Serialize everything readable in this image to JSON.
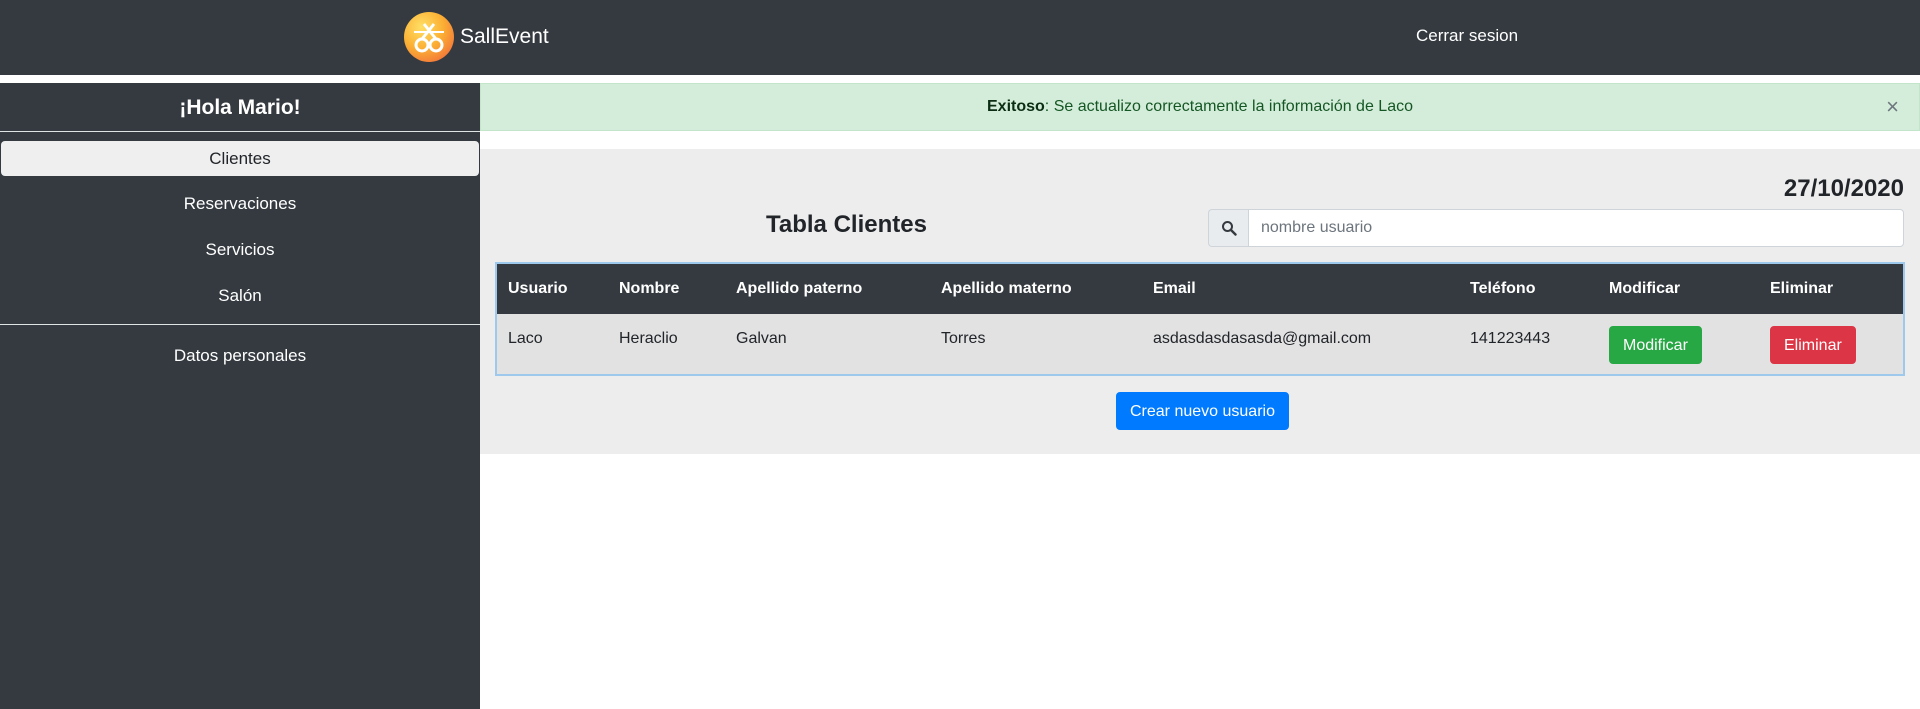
{
  "header": {
    "brand": "SallEvent",
    "logout_label": "Cerrar sesion"
  },
  "sidebar": {
    "greeting": "¡Hola Mario!",
    "items": [
      {
        "label": "Clientes",
        "active": true
      },
      {
        "label": "Reservaciones",
        "active": false
      },
      {
        "label": "Servicios",
        "active": false
      },
      {
        "label": "Salón",
        "active": false
      }
    ],
    "personal_label": "Datos personales"
  },
  "alert": {
    "strong": "Exitoso",
    "message": ": Se actualizo correctamente la información de Laco",
    "close": "×"
  },
  "main": {
    "date": "27/10/2020",
    "title": "Tabla Clientes",
    "search_placeholder": "nombre usuario",
    "search_value": "",
    "columns": [
      "Usuario",
      "Nombre",
      "Apellido paterno",
      "Apellido materno",
      "Email",
      "Teléfono",
      "Modificar",
      "Eliminar"
    ],
    "rows": [
      {
        "usuario": "Laco",
        "nombre": "Heraclio",
        "apellido_paterno": "Galvan",
        "apellido_materno": "Torres",
        "email": "asdasdasdasasda@gmail.com",
        "telefono": "141223443",
        "modify_label": "Modificar",
        "delete_label": "Eliminar"
      }
    ],
    "create_label": "Crear nuevo usuario"
  },
  "colors": {
    "navbar": "#343a40",
    "alert_bg": "#d4edda",
    "success": "#28a745",
    "danger": "#dc3545",
    "primary": "#007bff"
  }
}
